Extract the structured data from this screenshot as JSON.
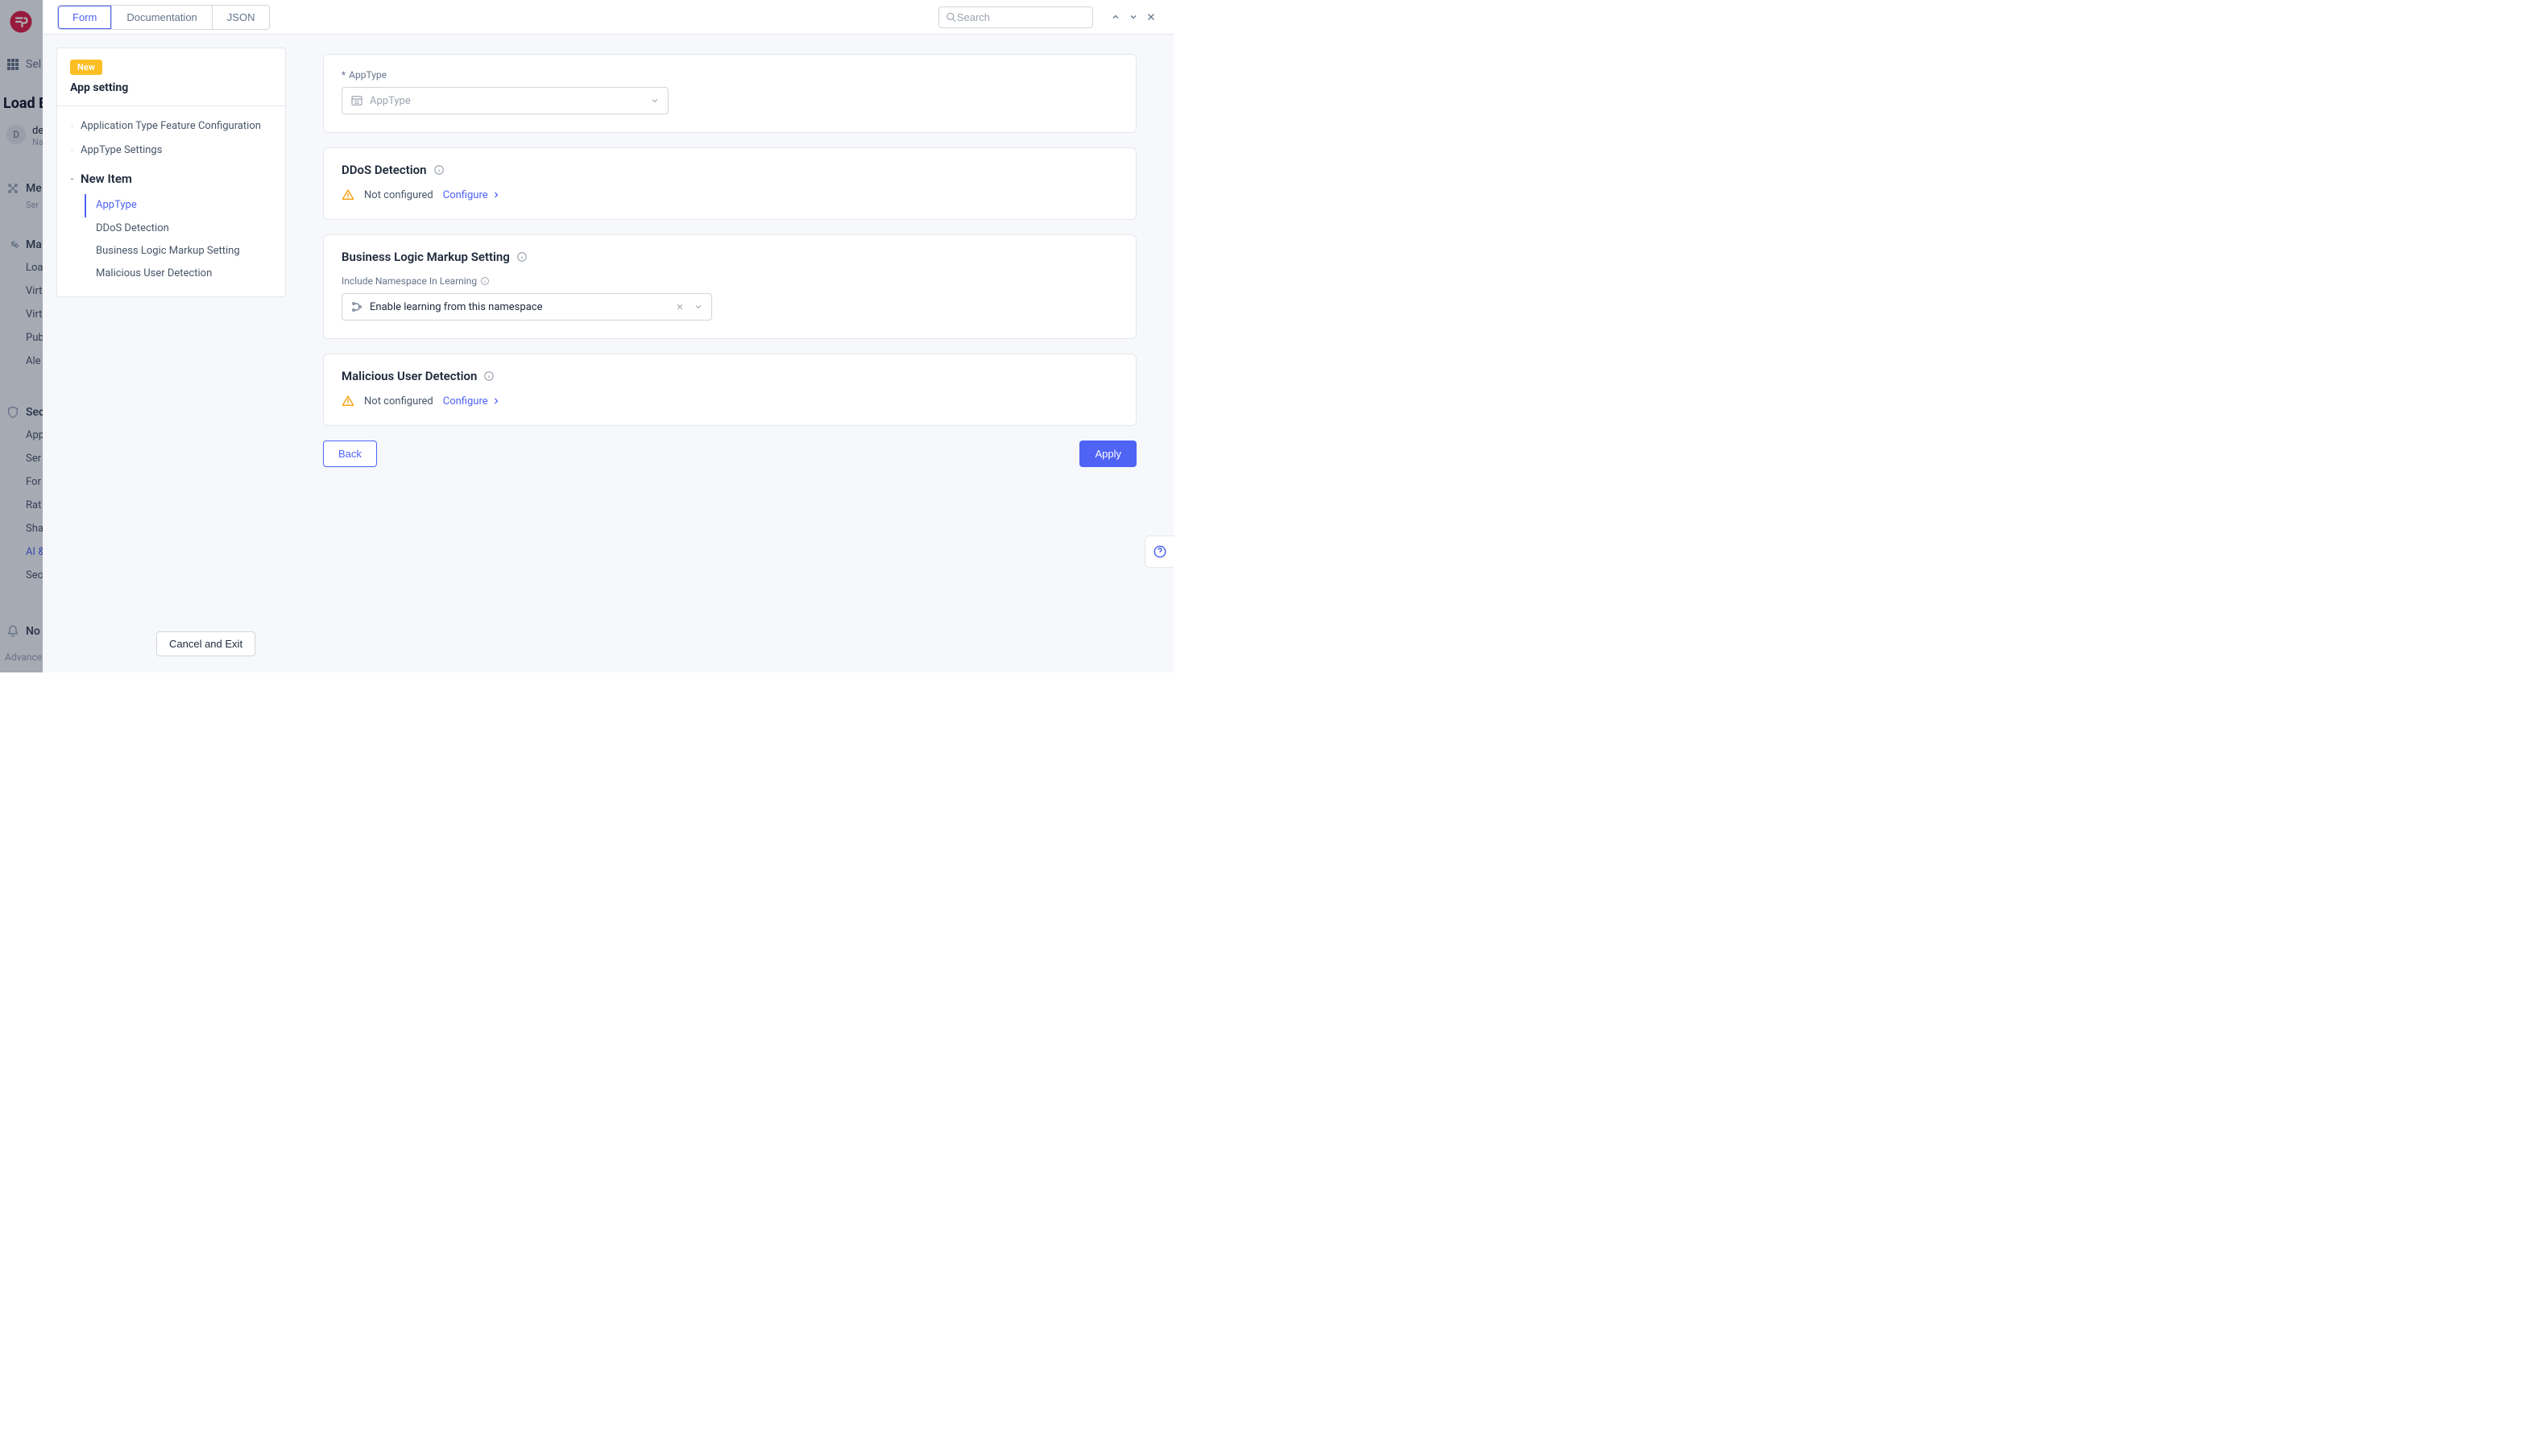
{
  "bg": {
    "title": "Load B",
    "select_label": "Sel",
    "user_avatar": "D",
    "user_name": "de",
    "user_sub": "Na",
    "groups": [
      {
        "header": "Me",
        "sub": "Ser",
        "items": []
      },
      {
        "header": "Ma",
        "sub": "",
        "items": [
          "Loa",
          "Virt",
          "Virt",
          "Pub",
          "Ale"
        ]
      },
      {
        "header": "Sec",
        "sub": "",
        "items": [
          "App",
          "Ser",
          "For",
          "Rat",
          "Sha",
          "AI &",
          "Sec"
        ]
      },
      {
        "header": "No",
        "sub": "",
        "items": []
      }
    ],
    "footer": "Advance"
  },
  "topbar": {
    "tabs": [
      "Form",
      "Documentation",
      "JSON"
    ],
    "active_tab_index": 0,
    "search_placeholder": "Search"
  },
  "leftnav": {
    "badge": "New",
    "title": "App setting",
    "top_items": [
      "Application Type Feature Configuration",
      "AppType Settings"
    ],
    "expanded": "New Item",
    "sub_items": [
      "AppType",
      "DDoS Detection",
      "Business Logic Markup Setting",
      "Malicious User Detection"
    ],
    "active_sub_index": 0,
    "cancel_exit": "Cancel and Exit"
  },
  "main": {
    "apptype": {
      "label": "AppType",
      "placeholder": "AppType"
    },
    "ddos": {
      "title": "DDoS Detection",
      "status": "Not configured",
      "configure": "Configure"
    },
    "blms": {
      "title": "Business Logic Markup Setting",
      "field_label": "Include Namespace In Learning",
      "value": "Enable learning from this namespace"
    },
    "mud": {
      "title": "Malicious User Detection",
      "status": "Not configured",
      "configure": "Configure"
    },
    "buttons": {
      "back": "Back",
      "apply": "Apply"
    }
  }
}
